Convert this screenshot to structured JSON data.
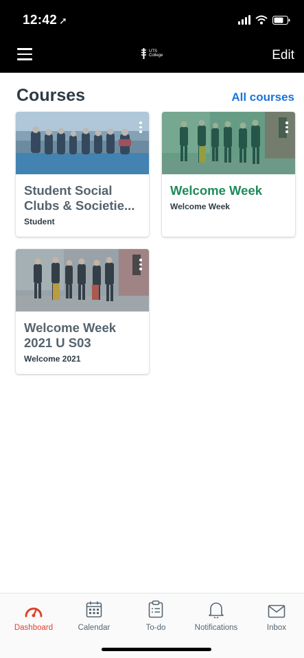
{
  "status_bar": {
    "time": "12:42",
    "location_icon": "location-arrow-icon",
    "signal_icon": "cellular-signal-icon",
    "wifi_icon": "wifi-icon",
    "battery_icon": "battery-icon"
  },
  "nav": {
    "menu_icon": "hamburger-menu-icon",
    "logo_text_1": "UTS",
    "logo_text_2": "College",
    "edit_label": "Edit"
  },
  "courses_section": {
    "title": "Courses",
    "all_courses_label": "All courses",
    "cards": [
      {
        "title": "Student Social Clubs & Societie...",
        "subtitle": "Student",
        "title_color": "#55636e",
        "image_tint": "#4a8fc0",
        "image": "group-seated-photo"
      },
      {
        "title": "Welcome Week",
        "subtitle": "Welcome Week",
        "title_color": "#1e8a5a",
        "image_tint": "#2f8f6a",
        "image": "group-walking-photo"
      },
      {
        "title": "Welcome Week 2021 U S03",
        "subtitle": "Welcome 2021",
        "title_color": "#55636e",
        "image_tint": "#6d7c85",
        "image": "group-walking-photo"
      }
    ]
  },
  "tab_bar": {
    "tabs": [
      {
        "label": "Dashboard",
        "icon": "dashboard-gauge-icon",
        "active": true
      },
      {
        "label": "Calendar",
        "icon": "calendar-icon",
        "active": false
      },
      {
        "label": "To-do",
        "icon": "clipboard-icon",
        "active": false
      },
      {
        "label": "Notifications",
        "icon": "bell-icon",
        "active": false
      },
      {
        "label": "Inbox",
        "icon": "envelope-icon",
        "active": false
      }
    ]
  },
  "colors": {
    "accent": "#e0422f",
    "link": "#1a73d9",
    "nav_bg": "#000000"
  }
}
